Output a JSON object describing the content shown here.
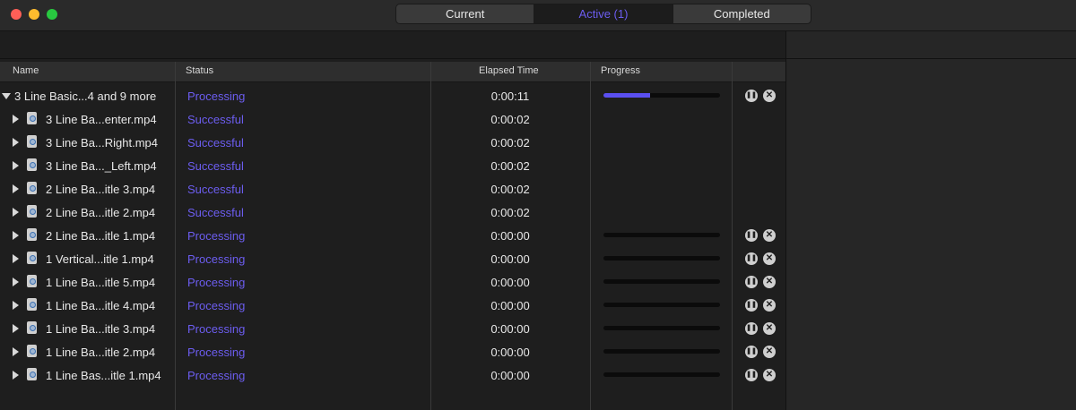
{
  "tabs": [
    {
      "label": "Current",
      "active": false
    },
    {
      "label": "Active (1)",
      "active": true
    },
    {
      "label": "Completed",
      "active": false
    }
  ],
  "columns": {
    "name": "Name",
    "status": "Status",
    "elapsed": "Elapsed Time",
    "progress": "Progress"
  },
  "colors": {
    "accent": "#6c5df0",
    "progress_fill": "#5a4ff0"
  },
  "rows": [
    {
      "name": "3 Line Basic...4 and 9 more",
      "status": "Processing",
      "elapsed": "0:00:11",
      "progress": 0.4,
      "is_group": true,
      "controls": true
    },
    {
      "name": "3 Line Ba...enter.mp4",
      "status": "Successful",
      "elapsed": "0:00:02",
      "progress": null,
      "is_group": false,
      "controls": false
    },
    {
      "name": "3 Line Ba...Right.mp4",
      "status": "Successful",
      "elapsed": "0:00:02",
      "progress": null,
      "is_group": false,
      "controls": false
    },
    {
      "name": "3 Line Ba..._Left.mp4",
      "status": "Successful",
      "elapsed": "0:00:02",
      "progress": null,
      "is_group": false,
      "controls": false
    },
    {
      "name": "2 Line Ba...itle 3.mp4",
      "status": "Successful",
      "elapsed": "0:00:02",
      "progress": null,
      "is_group": false,
      "controls": false
    },
    {
      "name": "2 Line Ba...itle 2.mp4",
      "status": "Successful",
      "elapsed": "0:00:02",
      "progress": null,
      "is_group": false,
      "controls": false
    },
    {
      "name": "2 Line Ba...itle 1.mp4",
      "status": "Processing",
      "elapsed": "0:00:00",
      "progress": 0,
      "is_group": false,
      "controls": true
    },
    {
      "name": "1 Vertical...itle 1.mp4",
      "status": "Processing",
      "elapsed": "0:00:00",
      "progress": 0,
      "is_group": false,
      "controls": true
    },
    {
      "name": "1 Line Ba...itle 5.mp4",
      "status": "Processing",
      "elapsed": "0:00:00",
      "progress": 0,
      "is_group": false,
      "controls": true
    },
    {
      "name": "1 Line Ba...itle 4.mp4",
      "status": "Processing",
      "elapsed": "0:00:00",
      "progress": 0,
      "is_group": false,
      "controls": true
    },
    {
      "name": "1 Line Ba...itle 3.mp4",
      "status": "Processing",
      "elapsed": "0:00:00",
      "progress": 0,
      "is_group": false,
      "controls": true
    },
    {
      "name": "1 Line Ba...itle 2.mp4",
      "status": "Processing",
      "elapsed": "0:00:00",
      "progress": 0,
      "is_group": false,
      "controls": true
    },
    {
      "name": "1 Line Bas...itle 1.mp4",
      "status": "Processing",
      "elapsed": "0:00:00",
      "progress": 0,
      "is_group": false,
      "controls": true
    }
  ]
}
